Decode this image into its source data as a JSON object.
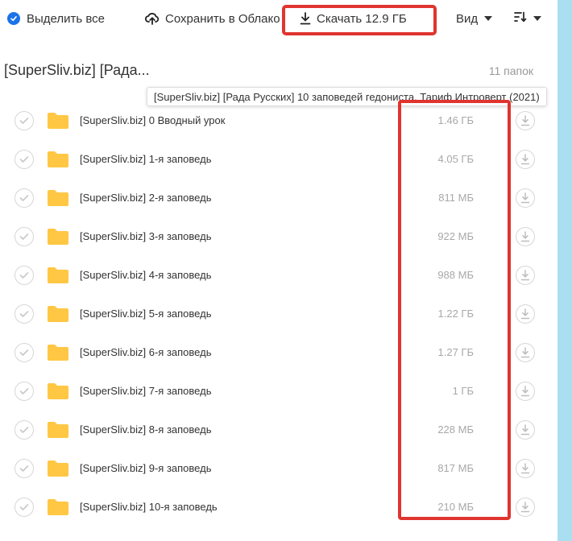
{
  "toolbar": {
    "select_all_label": "Выделить все",
    "save_cloud_label": "Сохранить в Облако",
    "download_label": "Скачать 12.9 ГБ",
    "view_label": "Вид"
  },
  "header": {
    "title": "[SuperSliv.biz] [Рада...",
    "count": "11 папок",
    "tooltip": "[SuperSliv.biz] [Рада Русских] 10 заповедей гедониста. Тариф Интроверт (2021)"
  },
  "colors": {
    "accent": "#1a73e8",
    "highlight": "#e0342f",
    "folder": "#ffc743",
    "side_strip": "#a9dff0"
  },
  "items": [
    {
      "name": "[SuperSliv.biz] 0 Вводный урок",
      "size": "1.46 ГБ"
    },
    {
      "name": "[SuperSliv.biz] 1-я заповедь",
      "size": "4.05 ГБ"
    },
    {
      "name": "[SuperSliv.biz] 2-я заповедь",
      "size": "811 МБ"
    },
    {
      "name": "[SuperSliv.biz] 3-я заповедь",
      "size": "922 МБ"
    },
    {
      "name": "[SuperSliv.biz] 4-я заповедь",
      "size": "988 МБ"
    },
    {
      "name": "[SuperSliv.biz] 5-я заповедь",
      "size": "1.22 ГБ"
    },
    {
      "name": "[SuperSliv.biz] 6-я заповедь",
      "size": "1.27 ГБ"
    },
    {
      "name": "[SuperSliv.biz] 7-я заповедь",
      "size": "1 ГБ"
    },
    {
      "name": "[SuperSliv.biz] 8-я заповедь",
      "size": "228 МБ"
    },
    {
      "name": "[SuperSliv.biz] 9-я заповедь",
      "size": "817 МБ"
    },
    {
      "name": "[SuperSliv.biz] 10-я заповедь",
      "size": "210 МБ"
    }
  ]
}
